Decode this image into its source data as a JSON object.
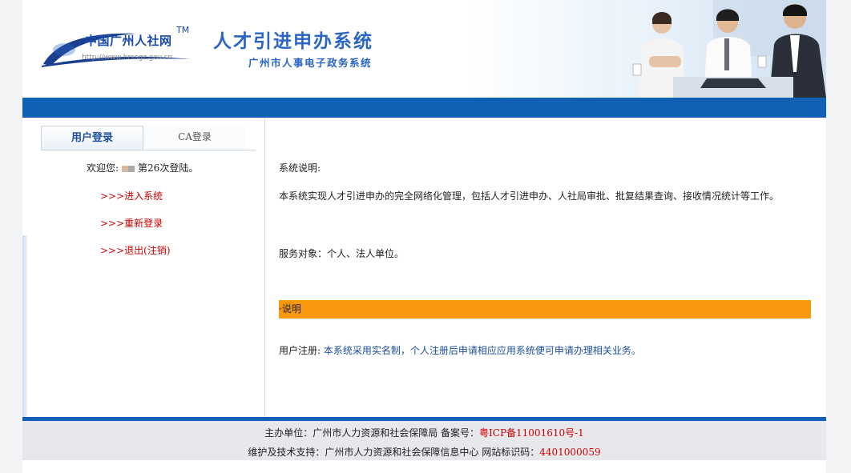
{
  "header": {
    "logo_text": "中国广州人社网",
    "logo_tm": "TM",
    "logo_url": "http://www.hrssgz.gov.cn",
    "title": "人才引进申办系统",
    "subtitle": "广州市人事电子政务系统"
  },
  "sidebar": {
    "tabs": [
      {
        "label": "用户登录",
        "active": true
      },
      {
        "label": "CA登录",
        "active": false
      }
    ],
    "welcome_prefix": "欢迎您:",
    "welcome_suffix": "第26次登陆。",
    "links": [
      {
        "label": ">>>进入系统"
      },
      {
        "label": ">>>重新登录"
      },
      {
        "label": ">>>退出(注销)"
      }
    ]
  },
  "main": {
    "desc_heading": "系统说明:",
    "desc_body": "本系统实现人才引进申办的完全网络化管理，包括人才引进申办、人社局审批、批复结果查询、接收情况统计等工作。",
    "service_target": "服务对象：个人、法人单位。",
    "notice_bar": "·说明",
    "register_label": "用户注册:",
    "register_body": "本系统采用实名制，个人注册后申请相应应用系统便可申请办理相关业务。"
  },
  "footer": {
    "host_label": "主办单位：广州市人力资源和社会保障局 备案号：",
    "icp": "粤ICP备11001610号-1",
    "support_label": "维护及技术支持：广州市人力资源和社会保障信息中心 网站标识码：",
    "site_code": "4401000059"
  },
  "colors": {
    "brand_blue": "#1061b5",
    "title_blue": "#2a66c4",
    "notice_orange": "#f7980f",
    "link_red": "#cc0000"
  }
}
